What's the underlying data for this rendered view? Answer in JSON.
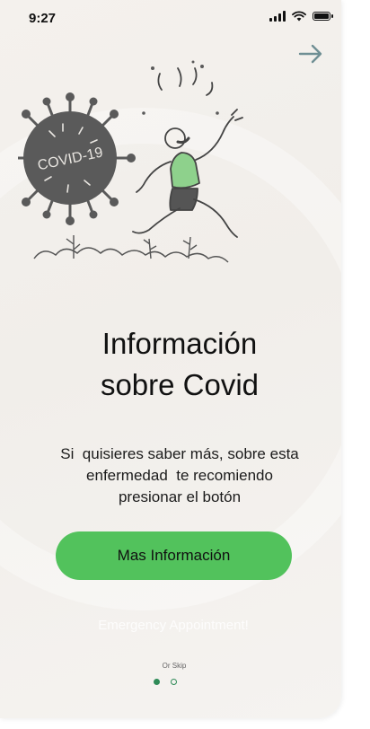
{
  "status_bar": {
    "time": "9:27",
    "icons": [
      "signal-icon",
      "wifi-icon",
      "battery-icon"
    ]
  },
  "navigation": {
    "next_icon": "arrow-right-icon"
  },
  "illustration": {
    "virus_text": "COVID-19",
    "icon": "running-person-virus-illustration"
  },
  "content": {
    "title_line1": "Información",
    "title_line2": "sobre Covid",
    "description_line1": "Si  quisieres saber más, sobre esta",
    "description_line2": "enfermedad  te recomiendo",
    "description_line3": "presionar el botón"
  },
  "actions": {
    "primary_label": "Mas Información",
    "secondary_label": "Emergency Appointment!",
    "skip_label": "Or Skip"
  },
  "pagination": {
    "total": 2,
    "current": 1
  },
  "colors": {
    "accent": "#52c25c",
    "dot": "#2e8b57",
    "background": "#f3f0ec",
    "arrow": "#6f8f94"
  }
}
